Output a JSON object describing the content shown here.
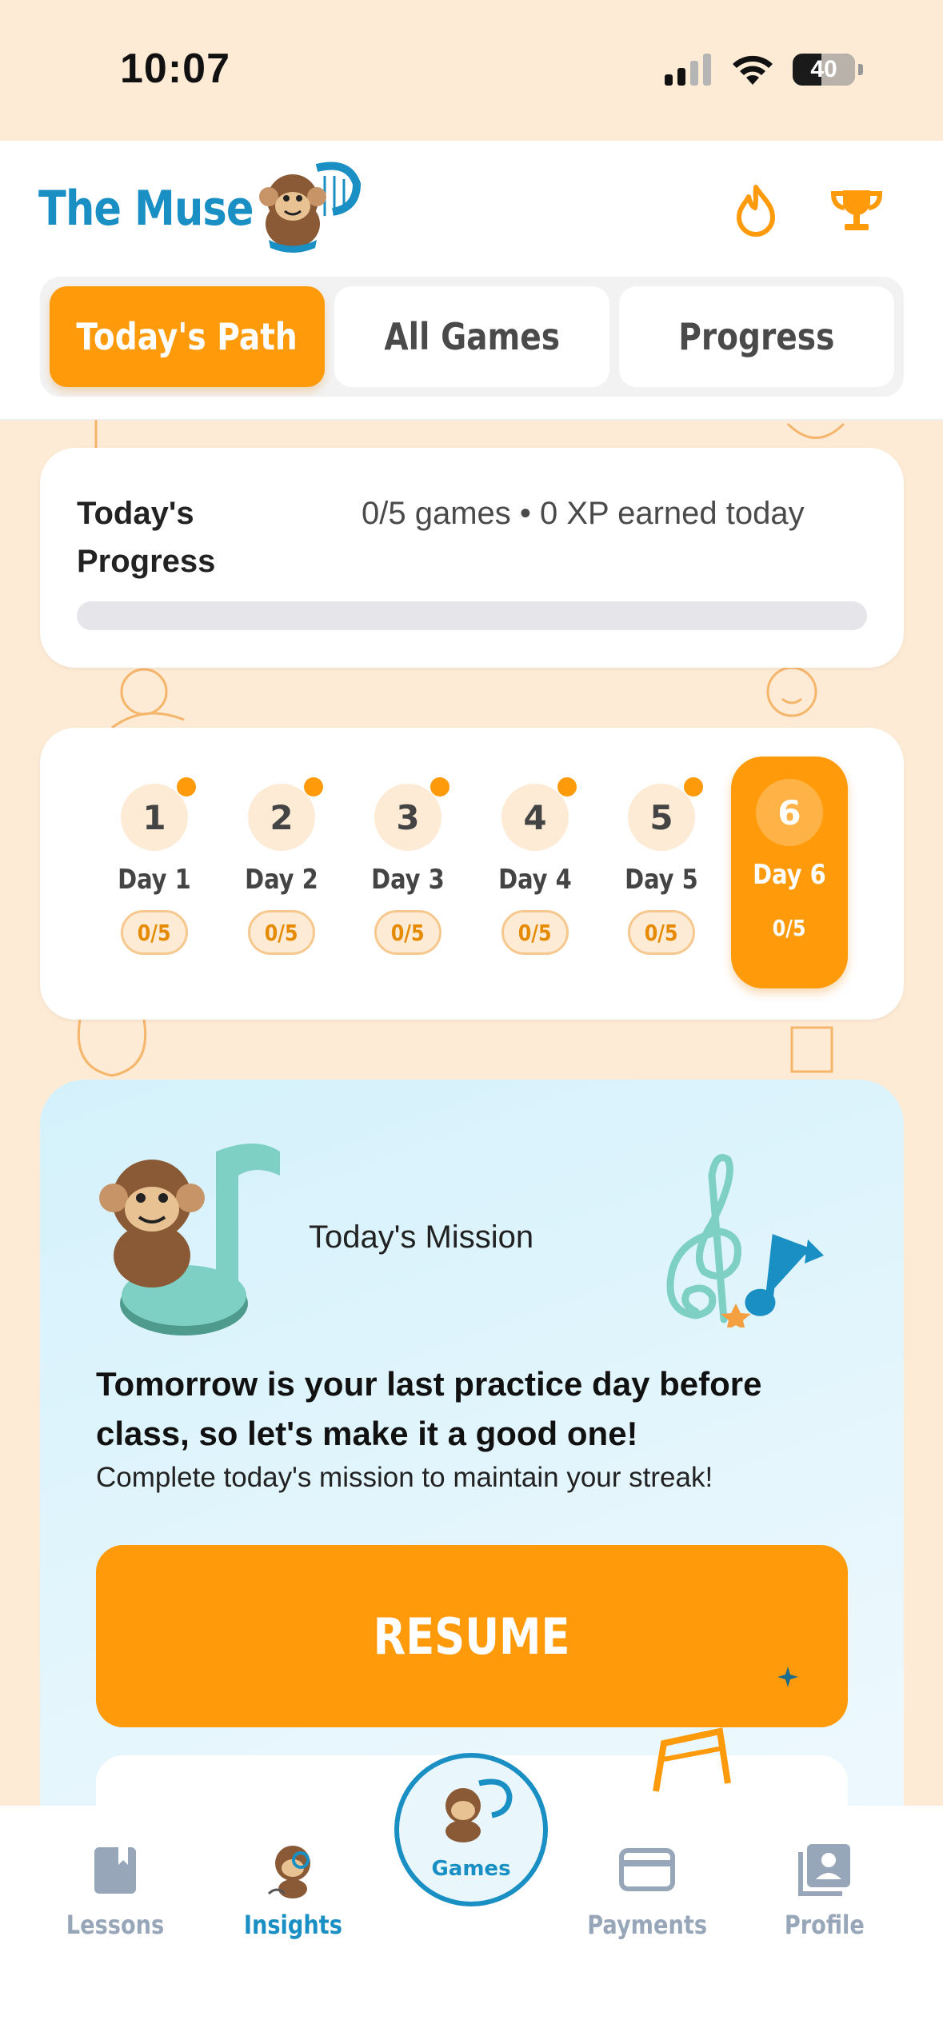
{
  "status_bar": {
    "time": "10:07",
    "battery": "40"
  },
  "header": {
    "title": "The Muse",
    "icons": [
      "fire-icon",
      "trophy-icon"
    ]
  },
  "tabs": [
    {
      "label": "Today's Path",
      "active": true
    },
    {
      "label": "All Games",
      "active": false
    },
    {
      "label": "Progress",
      "active": false
    }
  ],
  "todays_progress": {
    "title": "Today's Progress",
    "stats": "0/5 games • 0 XP earned today",
    "progress_fraction": 0
  },
  "days": [
    {
      "number": "1",
      "label": "Day 1",
      "score": "0/5",
      "active": false
    },
    {
      "number": "2",
      "label": "Day 2",
      "score": "0/5",
      "active": false
    },
    {
      "number": "3",
      "label": "Day 3",
      "score": "0/5",
      "active": false
    },
    {
      "number": "4",
      "label": "Day 4",
      "score": "0/5",
      "active": false
    },
    {
      "number": "5",
      "label": "Day 5",
      "score": "0/5",
      "active": false
    },
    {
      "number": "6",
      "label": "Day 6",
      "score": "0/5",
      "active": true
    }
  ],
  "mission": {
    "title": "Today's Mission",
    "headline": "Tomorrow is your last practice day before class, so let's make it a good one!",
    "subtitle": "Complete today's mission to maintain your streak!",
    "button_label": "RESUME"
  },
  "bottom_nav": {
    "lessons": "Lessons",
    "insights": "Insights",
    "games": "Games",
    "payments": "Payments",
    "profile": "Profile"
  },
  "colors": {
    "accent": "#ff9a0a",
    "brand": "#1a8fc4",
    "background": "#fdebd6"
  }
}
